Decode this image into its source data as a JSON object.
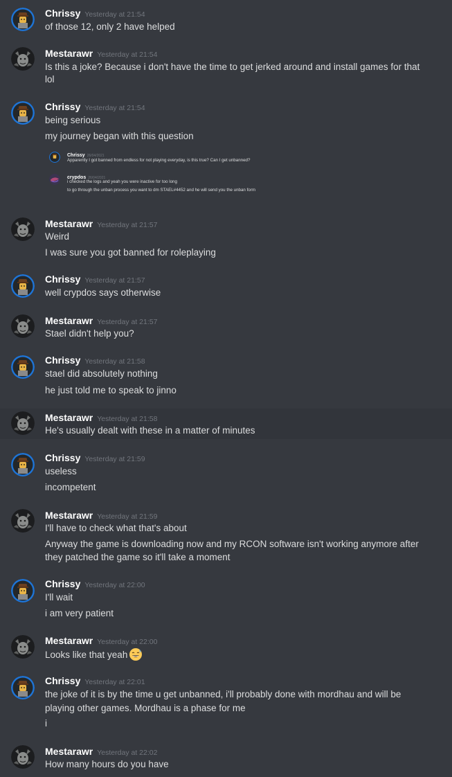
{
  "users": {
    "chrissy": {
      "name": "Chrissy",
      "avatar_icon": "lego-soldier-avatar-icon",
      "ring_color": "#1e74d6"
    },
    "mestarawr": {
      "name": "Mestarawr",
      "avatar_icon": "gargoyle-avatar-icon"
    }
  },
  "messages": [
    {
      "author": "Chrissy",
      "time": "Yesterday at 21:54",
      "lines": [
        "of those 12, only 2 have helped"
      ]
    },
    {
      "author": "Mestarawr",
      "time": "Yesterday at 21:54",
      "lines": [
        "Is this a joke? Because i don't have the time to get jerked around and install games for that",
        "lol"
      ]
    },
    {
      "author": "Chrissy",
      "time": "Yesterday at 21:54",
      "lines": [
        "being serious",
        "my journey began with this question"
      ]
    },
    {
      "author": "Mestarawr",
      "time": "Yesterday at 21:57",
      "lines": [
        "Weird",
        "I was sure you got banned for roleplaying"
      ]
    },
    {
      "author": "Chrissy",
      "time": "Yesterday at 21:57",
      "lines": [
        "well crypdos says otherwise"
      ]
    },
    {
      "author": "Mestarawr",
      "time": "Yesterday at 21:57",
      "lines": [
        "Stael didn't help you?"
      ]
    },
    {
      "author": "Chrissy",
      "time": "Yesterday at 21:58",
      "lines": [
        "stael did absolutely nothing",
        "he just told me to speak to jinno"
      ]
    },
    {
      "author": "Mestarawr",
      "time": "Yesterday at 21:58",
      "lines": [
        "He's usually dealt with these in a matter of minutes"
      ]
    },
    {
      "author": "Chrissy",
      "time": "Yesterday at 21:59",
      "lines": [
        "useless",
        "incompetent"
      ]
    },
    {
      "author": "Mestarawr",
      "time": "Yesterday at 21:59",
      "lines": [
        "I'll have to check what that's about",
        "Anyway the game is downloading now and my RCON software isn't working anymore after",
        "they patched the game so it'll take a moment"
      ]
    },
    {
      "author": "Chrissy",
      "time": "Yesterday at 22:00",
      "lines": [
        "I'll wait",
        "i am very patient"
      ]
    },
    {
      "author": "Mestarawr",
      "time": "Yesterday at 22:00",
      "lines": [
        "Looks like that yeah"
      ],
      "emoji": "grinning-sweat-emoji"
    },
    {
      "author": "Chrissy",
      "time": "Yesterday at 22:01",
      "lines": [
        "the joke of it is by the time u get unbanned, i'll probably done with mordhau and will be",
        "playing other games.  Mordhau is a phase for me",
        "i"
      ]
    },
    {
      "author": "Mestarawr",
      "time": "Yesterday at 22:02",
      "lines": [
        "How many hours do you have"
      ]
    }
  ],
  "embed": {
    "messages": [
      {
        "author": "Chrissy",
        "time": "26/04/2021",
        "lines": [
          "Apparently I got banned from endless for not playing everyday, is this true?  Can I get unbanned?"
        ]
      },
      {
        "author": "crypdos",
        "time": "26/04/2021",
        "lines": [
          "i checked the logs and yeah you were inactive for too long",
          "to go through the unban process you want to dm STAEL#4452 and he will send you the unban form"
        ]
      }
    ]
  }
}
